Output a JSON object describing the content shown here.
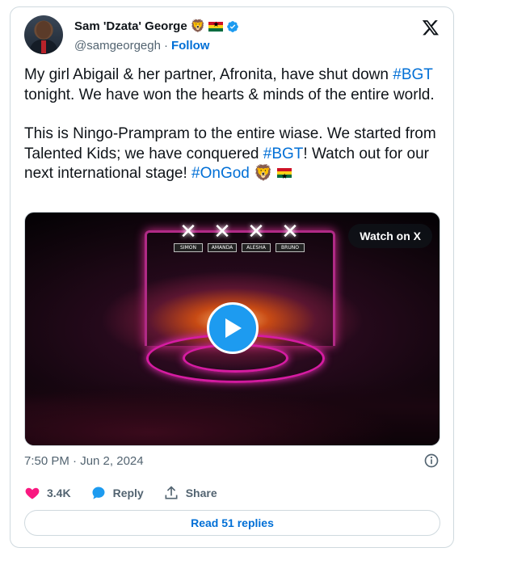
{
  "author": {
    "display_name": "Sam 'Dzata' George",
    "emojis": [
      "lion-emoji",
      "ghana-flag-emoji"
    ],
    "handle": "@samgeorgegh",
    "separator": "·",
    "follow_label": "Follow"
  },
  "tweet": {
    "paragraph1": {
      "part1": "My girl Abigail & her partner, Afronita, have shut down ",
      "hashtag1": "#BGT",
      "part2": " tonight. We have won the hearts & minds of the entire world."
    },
    "paragraph2": {
      "part1": "This is Ningo-Prampram to the entire wiase. We started from Talented Kids; we have conquered ",
      "hashtag1": "#BGT",
      "part2": "! Watch out for our next international stage! ",
      "hashtag2": "#OnGod",
      "lion_emoji": "🦁"
    }
  },
  "media": {
    "watch_label": "Watch on X",
    "judges": [
      "SIMON",
      "AMANDA",
      "ALESHA",
      "BRUNO"
    ],
    "play_icon": "play-icon"
  },
  "meta": {
    "timestamp": "7:50 PM · Jun 2, 2024"
  },
  "actions": {
    "likes_count": "3.4K",
    "reply_label": "Reply",
    "share_label": "Share"
  },
  "footer": {
    "read_replies_label": "Read 51 replies"
  },
  "colors": {
    "link_blue": "#006fd6",
    "verified_blue": "#1d9bf0",
    "like_pink": "#f91880",
    "muted": "#536471"
  }
}
